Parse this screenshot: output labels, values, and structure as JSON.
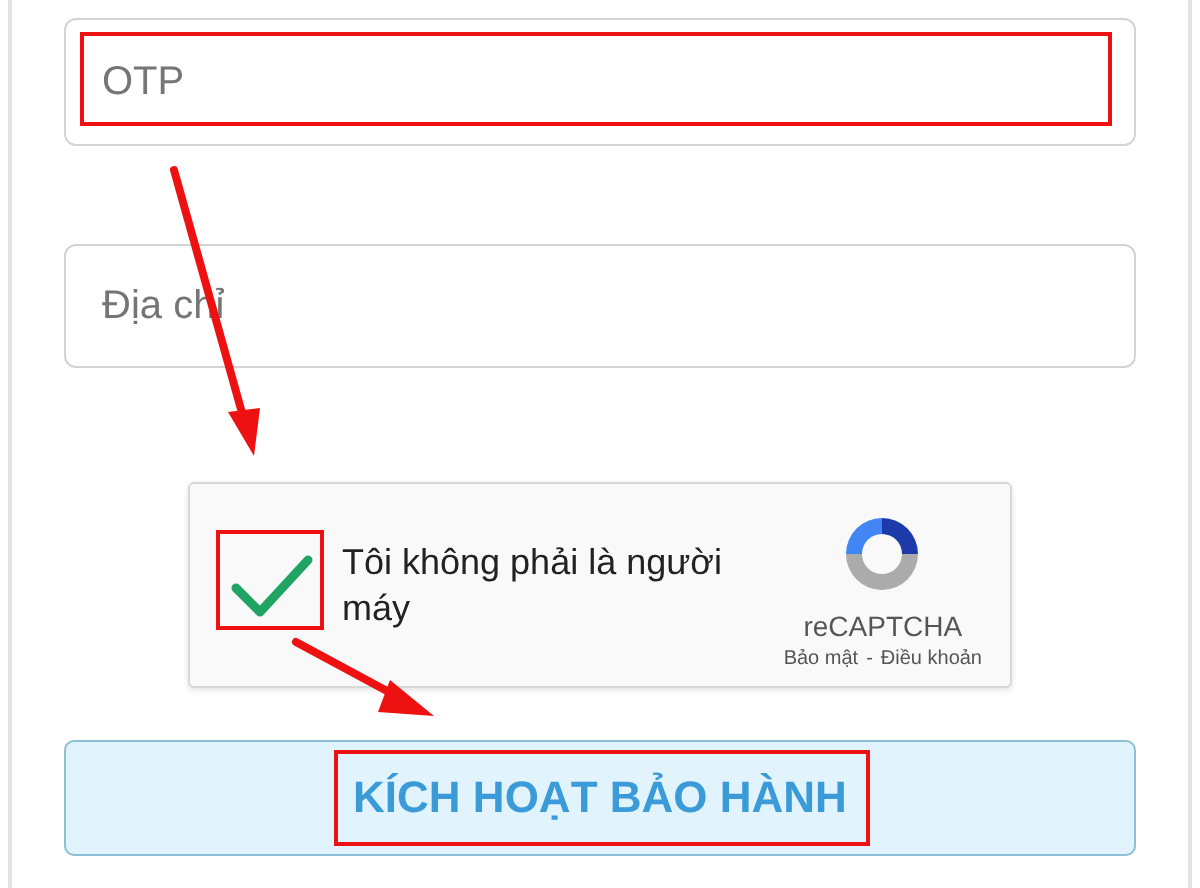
{
  "fields": [
    {
      "placeholder": "OTP",
      "highlighted": true
    },
    {
      "placeholder": "Địa chỉ",
      "highlighted": false
    }
  ],
  "captcha": {
    "checked": true,
    "label": "Tôi không phải là người máy",
    "brand": "reCAPTCHA",
    "links": [
      "Bảo mật",
      "Điều khoản"
    ],
    "separator": "-"
  },
  "submit_button": {
    "label": "KÍCH HOẠT BẢO HÀNH"
  }
}
